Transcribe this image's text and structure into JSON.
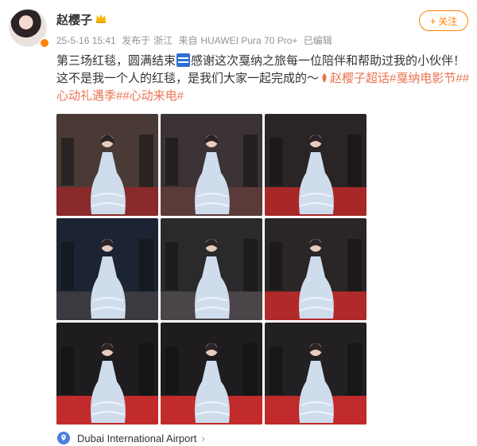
{
  "user": {
    "name": "赵樱子"
  },
  "meta": {
    "date": "25-5-16 15:41",
    "posted_from_prefix": "发布于",
    "province": "浙江",
    "source_prefix": "来自",
    "device": "HUAWEI Pura 70 Pro+",
    "edited": "已编辑"
  },
  "follow": {
    "label": "关注",
    "plus": "+"
  },
  "post": {
    "text1": "第三场红毯，圆满结束",
    "text2": "感谢这次戛纳之旅每一位陪伴和帮助过我的小伙伴！这不是我一个人的红毯，是我们大家一起完成的～",
    "hashtags": [
      "赵樱子超话",
      "#戛纳电影节#",
      "#心动礼遇季#",
      "#心动来电#"
    ]
  },
  "location": {
    "name": "Dubai International Airport",
    "chevron": "›"
  },
  "colors": {
    "accent": "#ff8200",
    "hashtag": "#eb7350",
    "meta": "#939393"
  },
  "photos": [
    {
      "bg": "#4a3a36",
      "carpet": "#8a2a2a"
    },
    {
      "bg": "#3a3234",
      "carpet": "#5a3b3a"
    },
    {
      "bg": "#2a2424",
      "carpet": "#a82828"
    },
    {
      "bg": "#1c2434",
      "carpet": "#3b3a40"
    },
    {
      "bg": "#2a2a2c",
      "carpet": "#4a4548"
    },
    {
      "bg": "#2a2626",
      "carpet": "#b02a2a"
    },
    {
      "bg": "#1e1c1e",
      "carpet": "#c22b2b"
    },
    {
      "bg": "#1e1c1e",
      "carpet": "#c22b2b"
    },
    {
      "bg": "#222022",
      "carpet": "#c02a2a"
    }
  ]
}
